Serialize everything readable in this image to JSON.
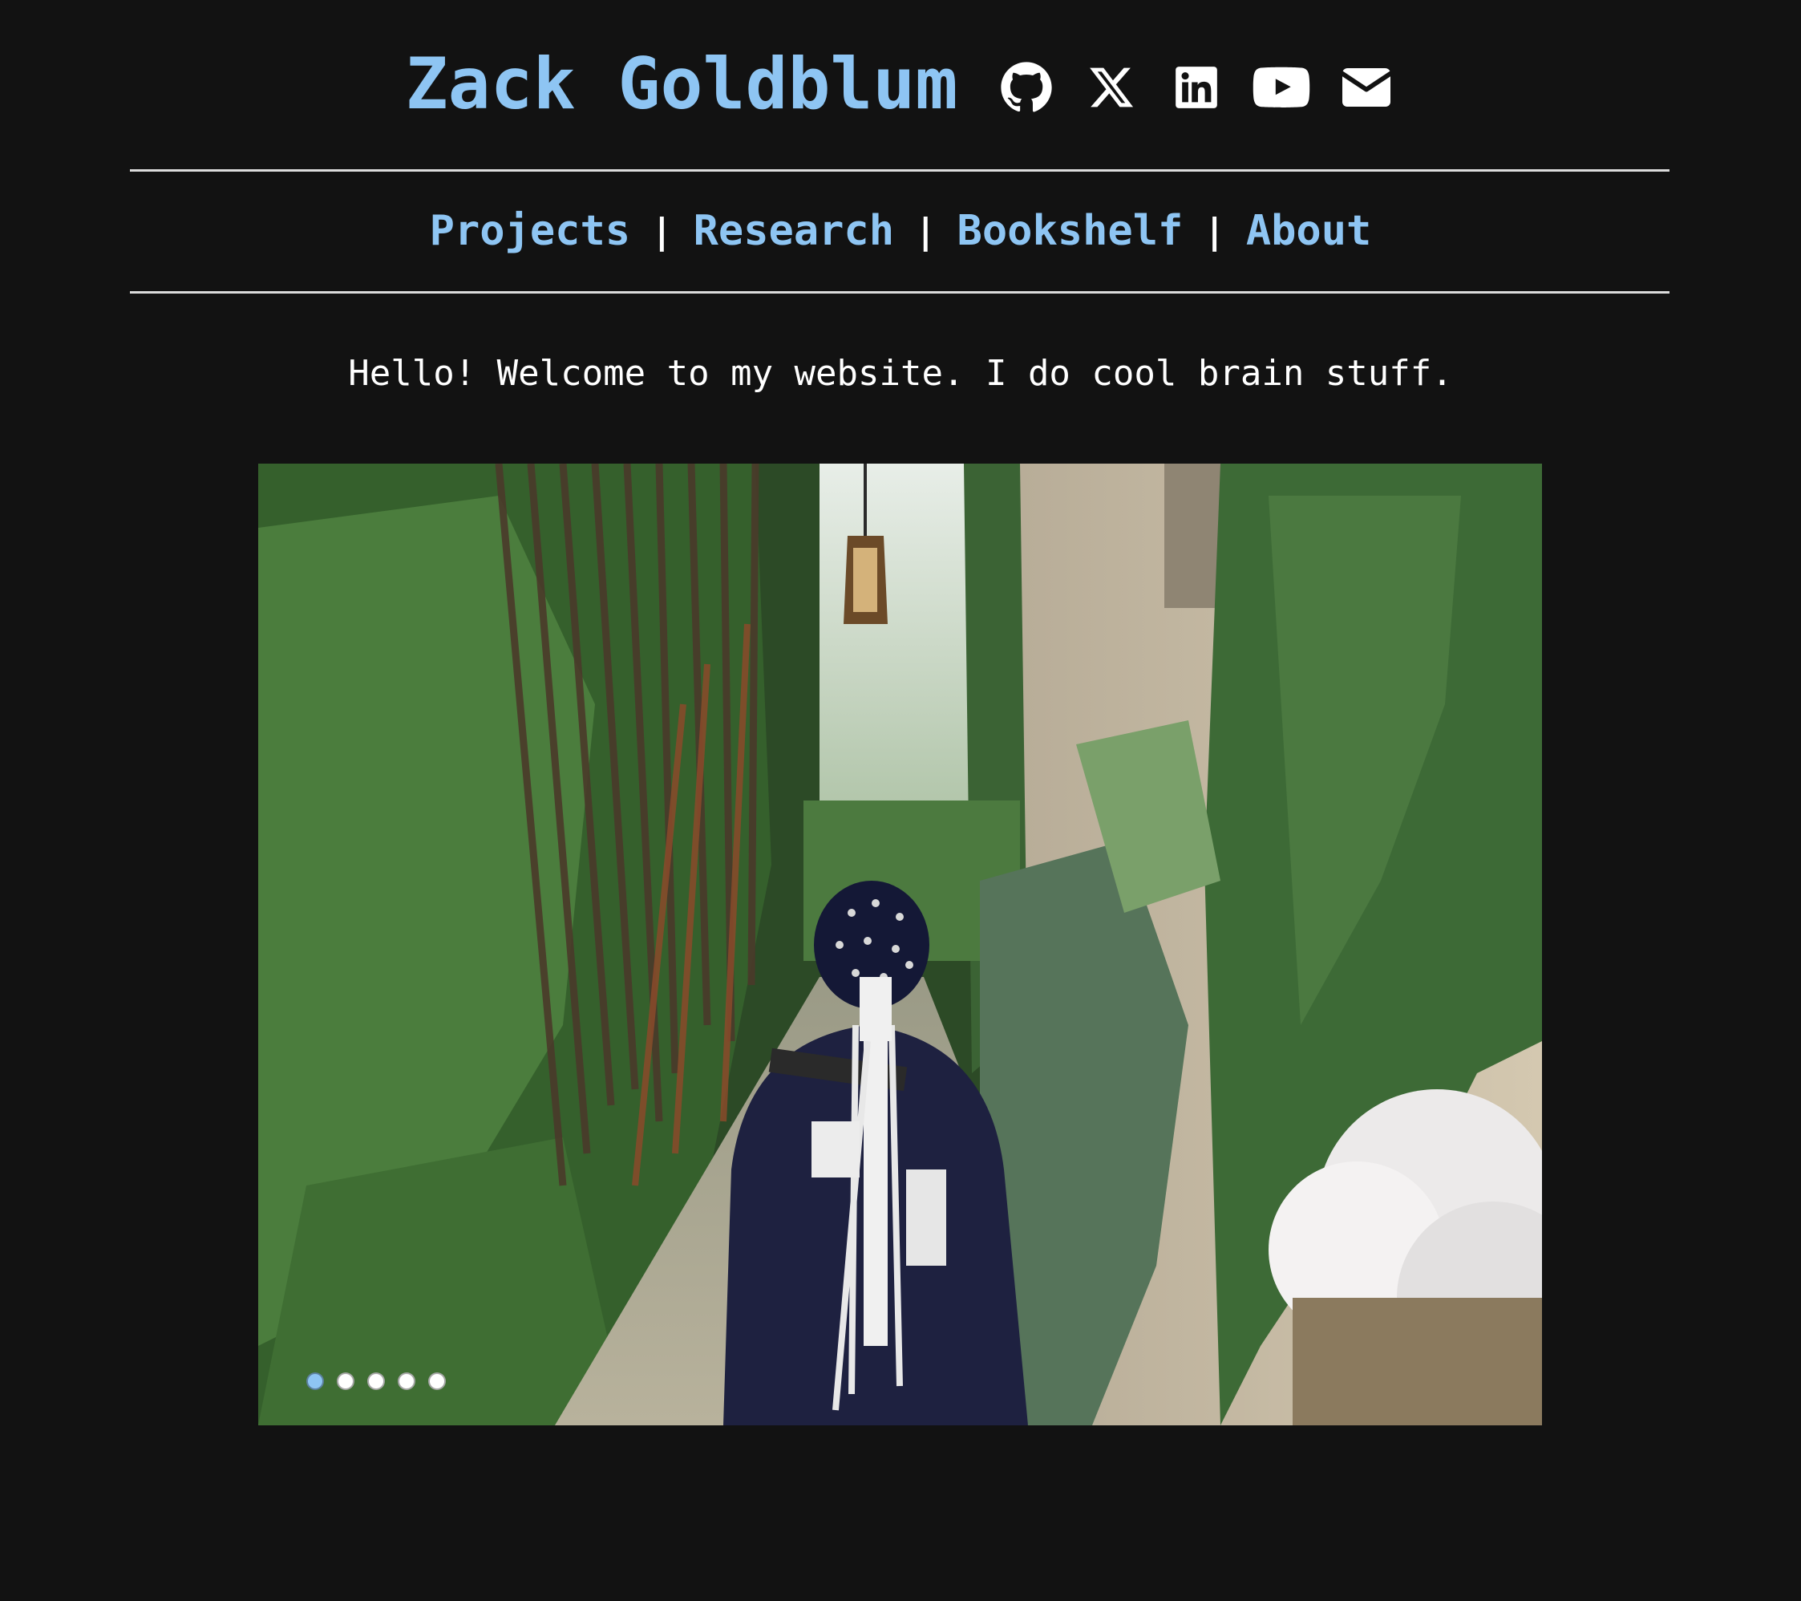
{
  "header": {
    "title": "Zack Goldblum",
    "social": [
      {
        "name": "github-icon"
      },
      {
        "name": "x-icon"
      },
      {
        "name": "linkedin-icon"
      },
      {
        "name": "youtube-icon"
      },
      {
        "name": "email-icon"
      }
    ]
  },
  "nav": {
    "items": [
      {
        "label": "Projects"
      },
      {
        "label": "Research"
      },
      {
        "label": "Bookshelf"
      },
      {
        "label": "About"
      }
    ],
    "separator": "|"
  },
  "intro": {
    "text": "Hello! Welcome to my website. I do cool brain stuff."
  },
  "slideshow": {
    "slide_count": 5,
    "active_index": 0
  },
  "colors": {
    "background": "#121212",
    "accent": "#8ec5f3",
    "text": "#ffffff",
    "rule": "#dcdcdc"
  }
}
